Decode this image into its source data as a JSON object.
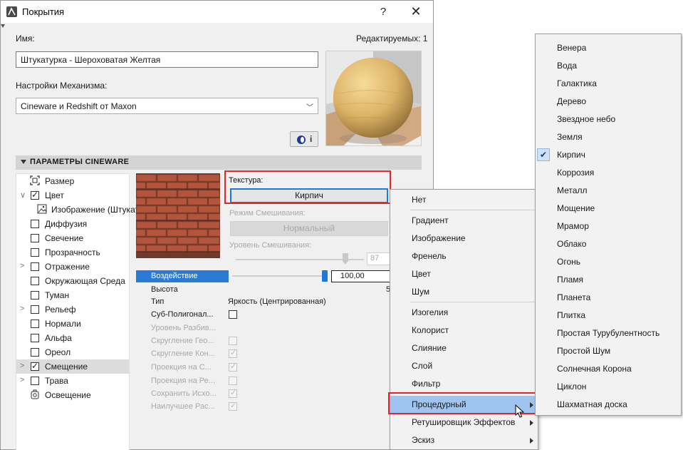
{
  "window": {
    "title": "Покрытия",
    "help": "?",
    "close": "✕"
  },
  "name": {
    "label": "Имя:",
    "value": "Штукатурка - Шероховатая Желтая",
    "editable_count": "Редактируемых: 1"
  },
  "engine": {
    "label": "Настройки Механизма:",
    "value": "Cineware и Redshift от Maxon"
  },
  "info_button": "i",
  "section": {
    "title": "ПАРАМЕТРЫ CINEWARE"
  },
  "channels": [
    {
      "label": "Размер",
      "icon": "size-icon",
      "expand": "",
      "checked": null
    },
    {
      "label": "Цвет",
      "icon": "",
      "expand": "∨",
      "checked": true
    },
    {
      "label": "Изображение (Штукатурка)",
      "icon": "image-icon",
      "expand": "",
      "checked": null
    },
    {
      "label": "Диффузия",
      "icon": "",
      "expand": "",
      "checked": false
    },
    {
      "label": "Свечение",
      "icon": "",
      "expand": "",
      "checked": false
    },
    {
      "label": "Прозрачность",
      "icon": "",
      "expand": "",
      "checked": false
    },
    {
      "label": "Отражение",
      "icon": "",
      "expand": ">",
      "checked": false
    },
    {
      "label": "Окружающая Среда",
      "icon": "",
      "expand": "",
      "checked": false
    },
    {
      "label": "Туман",
      "icon": "",
      "expand": "",
      "checked": false
    },
    {
      "label": "Рельеф",
      "icon": "",
      "expand": ">",
      "checked": false
    },
    {
      "label": "Нормали",
      "icon": "",
      "expand": "",
      "checked": false
    },
    {
      "label": "Альфа",
      "icon": "",
      "expand": "",
      "checked": false
    },
    {
      "label": "Ореол",
      "icon": "",
      "expand": "",
      "checked": false
    },
    {
      "label": "Смещение",
      "icon": "",
      "expand": ">",
      "checked": true,
      "selected": true
    },
    {
      "label": "Трава",
      "icon": "",
      "expand": ">",
      "checked": false
    },
    {
      "label": "Освещение",
      "icon": "light-icon",
      "expand": "",
      "checked": null
    }
  ],
  "texture": {
    "label": "Текстура:",
    "value": "Кирпич"
  },
  "blend_mode": {
    "label": "Режим Смешивания:",
    "value": "Нормальный"
  },
  "blend_level": {
    "label": "Уровень Смешивания:",
    "value": "87"
  },
  "properties": [
    {
      "name": "Воздействие",
      "value": "100,00",
      "active": true
    },
    {
      "name": "Высота",
      "value": "5"
    },
    {
      "name": "Тип",
      "value": "Яркость (Центрированная)"
    },
    {
      "name": "Суб-Полигонал...",
      "check": "off"
    },
    {
      "name": "Уровень Разбив...",
      "check": "none",
      "disabled": true
    },
    {
      "name": "Скругление Гео...",
      "check": "dis-off",
      "disabled": true
    },
    {
      "name": "Скругление Кон...",
      "check": "dis-on",
      "disabled": true
    },
    {
      "name": "Проекция на С...",
      "check": "dis-on",
      "disabled": true
    },
    {
      "name": "Проекция на Ре...",
      "check": "dis-off",
      "disabled": true
    },
    {
      "name": "Сохранить Исхо...",
      "check": "dis-on",
      "disabled": true
    },
    {
      "name": "Наилучшее Рас...",
      "check": "dis-on",
      "disabled": true
    }
  ],
  "texture_menu": {
    "items": [
      {
        "label": "Нет",
        "sep_after": true
      },
      {
        "label": "Градиент"
      },
      {
        "label": "Изображение"
      },
      {
        "label": "Френель"
      },
      {
        "label": "Цвет"
      },
      {
        "label": "Шум",
        "sep_after": true
      },
      {
        "label": "Изогелия"
      },
      {
        "label": "Колорист"
      },
      {
        "label": "Слияние"
      },
      {
        "label": "Слой"
      },
      {
        "label": "Фильтр",
        "sep_after": true
      },
      {
        "label": "Процедурный",
        "submenu": true,
        "highlighted": true
      },
      {
        "label": "Ретушировщик Эффектов",
        "submenu": true
      },
      {
        "label": "Эскиз",
        "submenu": true
      }
    ]
  },
  "procedural_menu": {
    "items": [
      "Венера",
      "Вода",
      "Галактика",
      "Дерево",
      "Звездное небо",
      "Земля",
      "Кирпич",
      "Коррозия",
      "Металл",
      "Мощение",
      "Мрамор",
      "Облако",
      "Огонь",
      "Пламя",
      "Планета",
      "Плитка",
      "Простая Турубулентность",
      "Простой Шум",
      "Солнечная Корона",
      "Циклон",
      "Шахматная доска"
    ],
    "checked": "Кирпич"
  },
  "colors": {
    "accent": "#2b7bd6",
    "highlight": "#9ec4ef",
    "callout": "#e8242b"
  }
}
